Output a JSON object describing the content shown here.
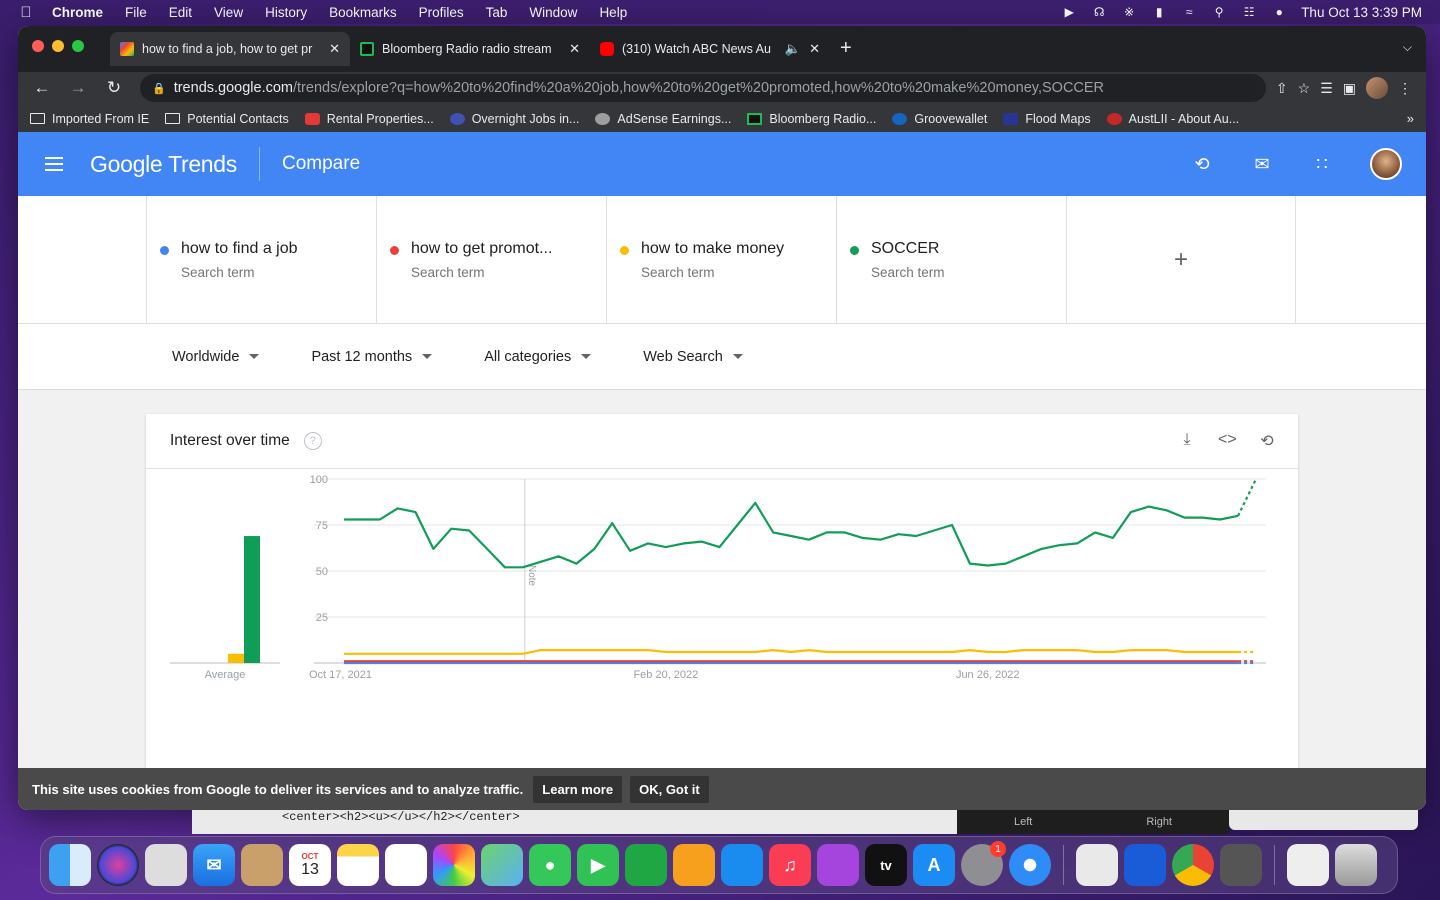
{
  "menubar": {
    "app": "Chrome",
    "items": [
      "File",
      "Edit",
      "View",
      "History",
      "Bookmarks",
      "Profiles",
      "Tab",
      "Window",
      "Help"
    ],
    "datetime": "Thu Oct 13  3:39 PM"
  },
  "tabs": [
    {
      "title": "how to find a job, how to get pr",
      "favicon_color": "#4285f4"
    },
    {
      "title": "Bloomberg Radio radio stream",
      "favicon_color": "#1db954"
    },
    {
      "title": "(310) Watch ABC News Au",
      "favicon_color": "#ff0000"
    }
  ],
  "omnibox": {
    "host": "trends.google.com",
    "path": "/trends/explore?q=how%20to%20find%20a%20job,how%20to%20get%20promoted,how%20to%20make%20money,SOCCER"
  },
  "bookmarks": [
    {
      "label": "Imported From IE",
      "icon": "folder-icon"
    },
    {
      "label": "Potential Contacts",
      "icon": "folder-icon"
    },
    {
      "label": "Rental Properties...",
      "icon": "house-icon",
      "color": "#e53935"
    },
    {
      "label": "Overnight Jobs in...",
      "icon": "arrow-icon",
      "color": "#3f51b5"
    },
    {
      "label": "AdSense Earnings...",
      "icon": "globe-icon",
      "color": "#9e9e9e"
    },
    {
      "label": "Bloomberg Radio...",
      "icon": "radio-icon",
      "color": "#1db954"
    },
    {
      "label": "Groovewallet",
      "icon": "c-icon",
      "color": "#1565c0"
    },
    {
      "label": "Flood Maps",
      "icon": "map-icon",
      "color": "#283593"
    },
    {
      "label": "AustLII - About Au...",
      "icon": "scale-icon",
      "color": "#c62828"
    }
  ],
  "header": {
    "logo_google": "Google",
    "logo_trends": "Trends",
    "section": "Compare"
  },
  "terms": [
    {
      "name": "how to find a job",
      "sub": "Search term",
      "color": "#4285f4"
    },
    {
      "name": "how to get promot...",
      "sub": "Search term",
      "color": "#ea4335"
    },
    {
      "name": "how to make money",
      "sub": "Search term",
      "color": "#fbbc04"
    },
    {
      "name": "SOCCER",
      "sub": "Search term",
      "color": "#0f9d58"
    }
  ],
  "add_term": "+",
  "filters": [
    "Worldwide",
    "Past 12 months",
    "All categories",
    "Web Search"
  ],
  "card": {
    "title": "Interest over time",
    "help": "?"
  },
  "chart_data": {
    "type": "line",
    "x_tick_labels": [
      "Oct 17, 2021",
      "Feb 20, 2022",
      "Jun 26, 2022"
    ],
    "y_ticks": [
      25,
      50,
      75,
      100
    ],
    "ylim": [
      0,
      100
    ],
    "annotation": "Note",
    "average_label": "Average",
    "averages": [
      {
        "name": "how to find a job",
        "value": 0
      },
      {
        "name": "how to get promoted",
        "value": 0
      },
      {
        "name": "how to make money",
        "value": 5
      },
      {
        "name": "SOCCER",
        "value": 69
      }
    ],
    "series": [
      {
        "name": "SOCCER",
        "color": "#0f9d58",
        "values": [
          78,
          78,
          78,
          84,
          82,
          62,
          73,
          72,
          62,
          52,
          52,
          55,
          58,
          54,
          62,
          76,
          61,
          65,
          63,
          65,
          66,
          63,
          75,
          87,
          71,
          69,
          67,
          71,
          71,
          68,
          67,
          70,
          69,
          72,
          75,
          54,
          53,
          54,
          58,
          62,
          64,
          65,
          71,
          68,
          82,
          85,
          83,
          79,
          79,
          78,
          80,
          100
        ]
      },
      {
        "name": "how to make money",
        "color": "#fbbc04",
        "values": [
          5,
          5,
          5,
          5,
          5,
          5,
          5,
          5,
          5,
          5,
          5,
          7,
          7,
          7,
          7,
          7,
          7,
          7,
          6,
          6,
          6,
          6,
          6,
          6,
          7,
          6,
          7,
          6,
          6,
          6,
          6,
          6,
          6,
          6,
          6,
          7,
          6,
          6,
          7,
          7,
          7,
          7,
          6,
          6,
          7,
          7,
          7,
          6,
          6,
          6,
          6,
          6
        ]
      },
      {
        "name": "how to get promoted",
        "color": "#ea4335",
        "values": [
          1,
          1,
          1,
          1,
          1,
          1,
          1,
          1,
          1,
          1,
          1,
          1,
          1,
          1,
          1,
          1,
          1,
          1,
          1,
          1,
          1,
          1,
          1,
          1,
          1,
          1,
          1,
          1,
          1,
          1,
          1,
          1,
          1,
          1,
          1,
          1,
          1,
          1,
          1,
          1,
          1,
          1,
          1,
          1,
          1,
          1,
          1,
          1,
          1,
          1,
          1,
          1
        ]
      },
      {
        "name": "how to find a job",
        "color": "#4285f4",
        "values": [
          0,
          0,
          0,
          0,
          0,
          0,
          0,
          0,
          0,
          0,
          0,
          0,
          0,
          0,
          0,
          0,
          0,
          0,
          0,
          0,
          0,
          0,
          0,
          0,
          0,
          0,
          0,
          0,
          0,
          0,
          0,
          0,
          0,
          0,
          0,
          0,
          0,
          0,
          0,
          0,
          0,
          0,
          0,
          0,
          0,
          0,
          0,
          0,
          0,
          0,
          0,
          0
        ]
      }
    ]
  },
  "cookie": {
    "text": "This site uses cookies from Google to deliver its services and to analyze traffic.",
    "learn_more": "Learn more",
    "ok": "OK, Got it"
  },
  "background": {
    "code_snippet": "<center><h2><u></u></h2></center>",
    "left": "Left",
    "right": "Right"
  },
  "dock": {
    "calendar_month": "OCT",
    "calendar_day": "13",
    "settings_badge": "1",
    "tv_label": "tv"
  }
}
